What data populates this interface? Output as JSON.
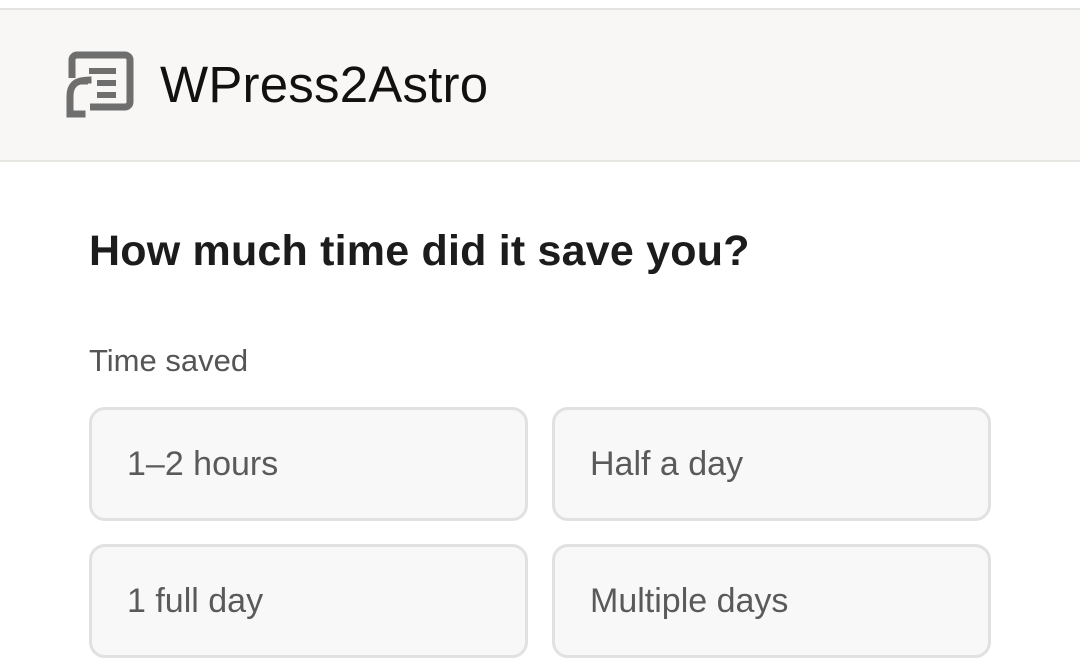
{
  "app": {
    "title": "WPress2Astro",
    "logo_icon": "document-migrate-icon"
  },
  "form": {
    "question": "How much time did it save you?",
    "field_label": "Time saved",
    "options": [
      {
        "label": "1–2 hours"
      },
      {
        "label": "Half a day"
      },
      {
        "label": "1 full day"
      },
      {
        "label": "Multiple days"
      }
    ]
  },
  "colors": {
    "header_background": "#f8f7f5",
    "option_background": "#f8f8f8",
    "option_border": "#e1e1e1",
    "text_primary": "#1c1c1c",
    "text_secondary": "#5a5a5a"
  }
}
